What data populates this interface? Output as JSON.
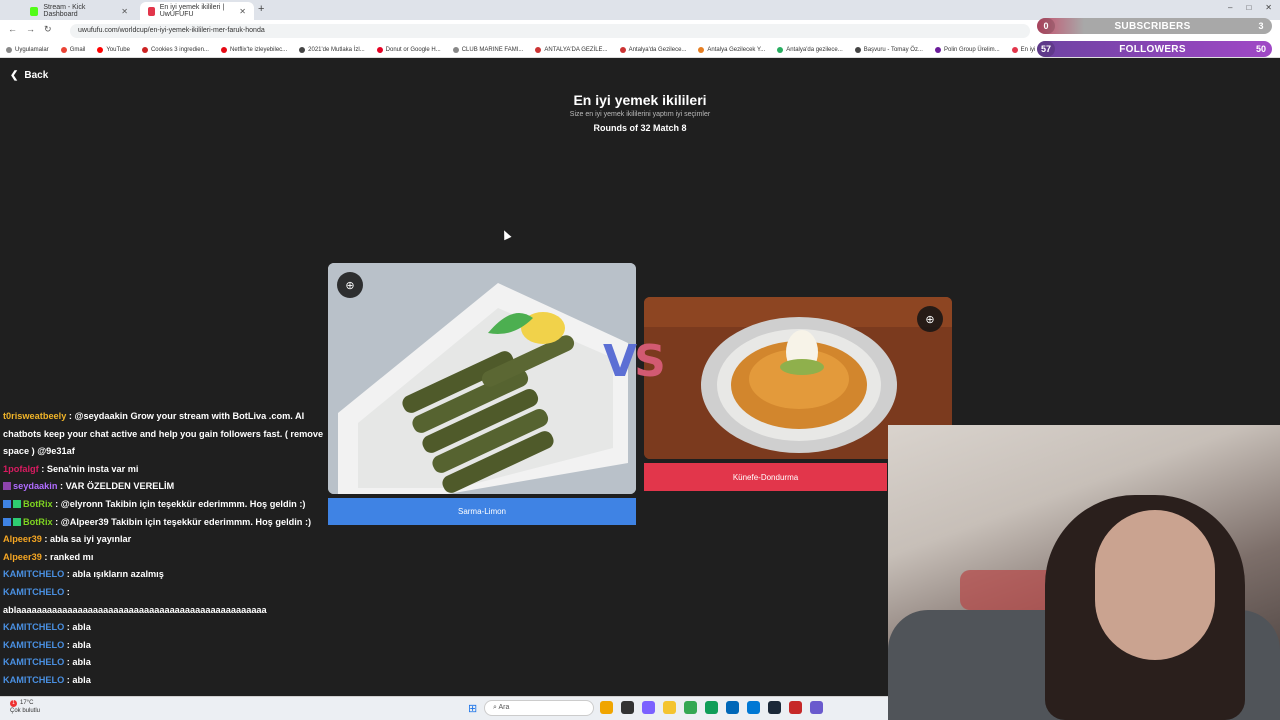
{
  "browser": {
    "tabs": [
      {
        "label": "Stream - Kick Dashboard",
        "color": "#53fc18"
      },
      {
        "label": "En iyi yemek ikilileri | UwUFUFU",
        "color": "#e2364b"
      }
    ],
    "new_tab": "+",
    "window_controls": [
      "–",
      "□",
      "✕"
    ],
    "url": "uwufufu.com/worldcup/en-iyi-yemek-ikilileri-mer-faruk-honda",
    "bookmarks": [
      {
        "label": "Uygulamalar",
        "color": "#888888"
      },
      {
        "label": "Gmail",
        "color": "#ea4335"
      },
      {
        "label": "YouTube",
        "color": "#ff0000"
      },
      {
        "label": "Cookies 3 ingredien...",
        "color": "#cc2222"
      },
      {
        "label": "Netflix'te izleyebilec...",
        "color": "#e50914"
      },
      {
        "label": "2021'de Mutlaka İzl...",
        "color": "#444444"
      },
      {
        "label": "Donut or Google H...",
        "color": "#e60023"
      },
      {
        "label": "CLUB MARINE FAMI...",
        "color": "#888888"
      },
      {
        "label": "ANTALYA'DA GEZİLE...",
        "color": "#cc3333"
      },
      {
        "label": "Antalya'da Gezilece...",
        "color": "#cc3333"
      },
      {
        "label": "Antalya Gezilecek Y...",
        "color": "#e67e22"
      },
      {
        "label": "Antalya'da gezilece...",
        "color": "#27ae60"
      },
      {
        "label": "Başvuru - Tomay Öz...",
        "color": "#444444"
      },
      {
        "label": "Polin Group Ürelim...",
        "color": "#6a1b9a"
      },
      {
        "label": "En iyi O...",
        "color": "#e2364b"
      }
    ]
  },
  "overlay": {
    "subscribers": {
      "left": "0",
      "label": "SUBSCRIBERS",
      "right": "3"
    },
    "followers": {
      "left": "57",
      "label": "FOLLOWERS",
      "right": "50"
    }
  },
  "page": {
    "back_label": "Back",
    "title": "En iyi yemek ikilileri",
    "subtitle": "Size en iyi yemek ikililerini yaptım iyi seçimler",
    "round": "Rounds of 32 Match 8",
    "vs_v": "V",
    "vs_s": "S",
    "left_choice": "Sarma-Limon",
    "right_choice": "Künefe-Dondurma"
  },
  "chat": [
    {
      "user": "t0risweatbeely",
      "color": "#f0b429",
      "text": "@seydaakin Grow your stream with BotLiva .com. AI chatbots keep your chat active and help you gain followers fast. ( remove space ) @9e31af",
      "badges": []
    },
    {
      "user": "1pofalgf",
      "color": "#d81b60",
      "text": "Sena'nin insta var mi",
      "badges": []
    },
    {
      "user": "seydaakin",
      "color": "#b06cff",
      "text": "VAR ÖZELDEN VERELİM",
      "badges": [
        "#8e44ad"
      ]
    },
    {
      "user": "BotRix",
      "color": "#7ed321",
      "text": "@elyronn Takibin için teşekkür ederimmm. Hoş geldin :)",
      "badges": [
        "#3f83e4",
        "#2ecc71"
      ]
    },
    {
      "user": "BotRix",
      "color": "#7ed321",
      "text": "@Alpeer39 Takibin için teşekkür ederimmm. Hoş geldin :)",
      "badges": [
        "#3f83e4",
        "#2ecc71"
      ]
    },
    {
      "user": "Alpeer39",
      "color": "#f5a623",
      "text": "abla sa iyi yayınlar",
      "badges": []
    },
    {
      "user": "Alpeer39",
      "color": "#f5a623",
      "text": "ranked mı",
      "badges": []
    },
    {
      "user": "KAMITCHELO",
      "color": "#4a90e2",
      "text": "abla ışıkların azalmış",
      "badges": []
    },
    {
      "user": "KAMITCHELO",
      "color": "#4a90e2",
      "text": "ablaaaaaaaaaaaaaaaaaaaaaaaaaaaaaaaaaaaaaaaaaaaaaaaaa",
      "badges": []
    },
    {
      "user": "KAMITCHELO",
      "color": "#4a90e2",
      "text": "abla",
      "badges": []
    },
    {
      "user": "KAMITCHELO",
      "color": "#4a90e2",
      "text": "abla",
      "badges": []
    },
    {
      "user": "KAMITCHELO",
      "color": "#4a90e2",
      "text": "abla",
      "badges": []
    },
    {
      "user": "KAMITCHELO",
      "color": "#4a90e2",
      "text": "abla",
      "badges": []
    }
  ],
  "taskbar": {
    "weather_temp": "17°C",
    "weather_desc": "Çok bulutlu",
    "notification_count": "1",
    "search_placeholder": "Ara",
    "app_colors": [
      "#f0a500",
      "#333333",
      "#7b61ff",
      "#f4c430",
      "#34a853",
      "#0f9d58",
      "#0067b8",
      "#0078d4",
      "#1b2838",
      "#c62828",
      "#6a5acd"
    ]
  }
}
